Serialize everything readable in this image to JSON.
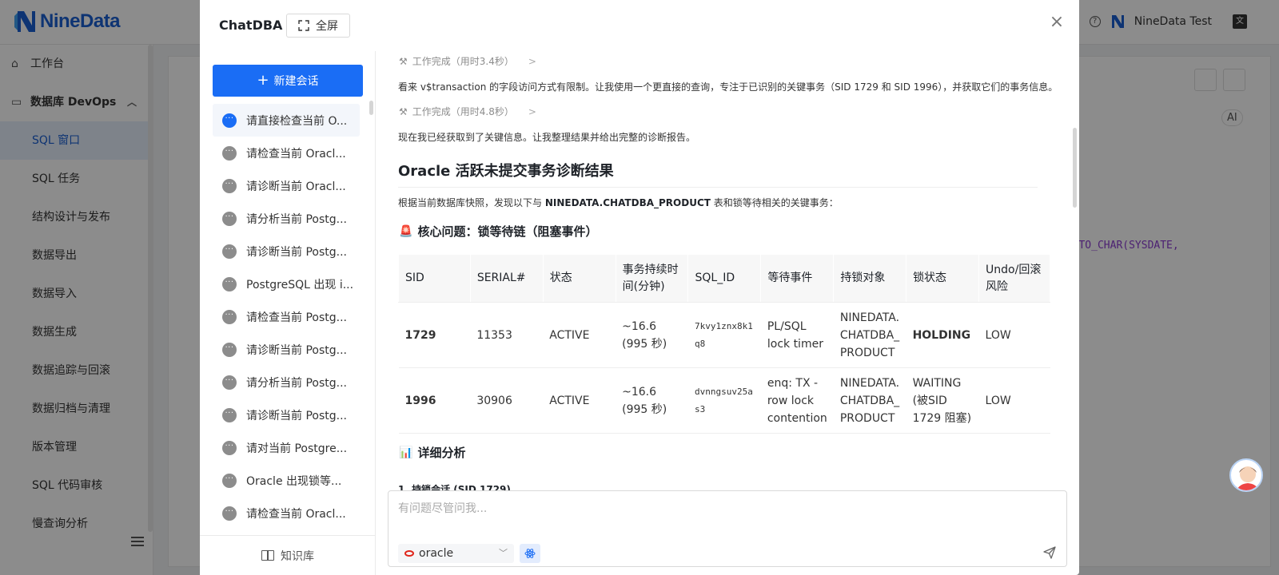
{
  "app": {
    "brand": "NineData",
    "user_name": "NineData Test",
    "help_glyph": "?",
    "lang_glyph": "文"
  },
  "sidebar": {
    "workbench": "工作台",
    "section_title": "数据库 DevOps",
    "items": [
      {
        "label": "SQL 窗口",
        "active": true
      },
      {
        "label": "SQL 任务"
      },
      {
        "label": "结构设计与发布"
      },
      {
        "label": "数据导出"
      },
      {
        "label": "数据导入"
      },
      {
        "label": "数据生成"
      },
      {
        "label": "数据追踪与回滚"
      },
      {
        "label": "数据归档与清理"
      },
      {
        "label": "版本管理"
      },
      {
        "label": "SQL 代码审核"
      },
      {
        "label": "慢查询分析"
      }
    ]
  },
  "background": {
    "code_fragment": "|| TO_CHAR(SYSDATE,",
    "ai_label": "AI"
  },
  "modal": {
    "title": "ChatDBA",
    "fullscreen_label": "全屏",
    "close_glyph": "×"
  },
  "conversations": {
    "new_chat_label": "新建会话",
    "items": [
      {
        "label": "请直接检查当前 O...",
        "active": true
      },
      {
        "label": "请检查当前 Oracl..."
      },
      {
        "label": "请诊断当前 Oracl..."
      },
      {
        "label": "请分析当前 Postg..."
      },
      {
        "label": "请诊断当前 Postg..."
      },
      {
        "label": "PostgreSQL 出现 i..."
      },
      {
        "label": "请检查当前 Postg..."
      },
      {
        "label": "请诊断当前 Postg..."
      },
      {
        "label": "请分析当前 Postg..."
      },
      {
        "label": "请诊断当前 Postg..."
      },
      {
        "label": "请对当前 Postgre..."
      },
      {
        "label": "Oracle 出现锁等..."
      },
      {
        "label": "请检查当前 Oracl..."
      }
    ],
    "knowledge_base_label": "知识库"
  },
  "chat": {
    "step1": "工作完成（用时3.4秒）",
    "para1": "看来 v$transaction 的字段访问方式有限制。让我使用一个更直接的查询，专注于已识别的关键事务（SID 1729 和 SID 1996），并获取它们的事务信息。",
    "step2": "工作完成（用时4.8秒）",
    "para2": "现在我已经获取到了关键信息。让我整理结果并给出完整的诊断报告。",
    "heading": "Oracle 活跃未提交事务诊断结果",
    "intro_prefix": "根据当前数据库快照，发现以下与 ",
    "intro_bold": "NINEDATA.CHATDBA_PRODUCT",
    "intro_suffix": " 表和锁等待相关的关键事务：",
    "core_issue": "核心问题：锁等待链（阻塞事件）",
    "table": {
      "headers": [
        "SID",
        "SERIAL#",
        "状态",
        "事务持续时间(分钟)",
        "SQL_ID",
        "等待事件",
        "持锁对象",
        "锁状态",
        "Undo/回滚风险"
      ],
      "rows": [
        [
          "1729",
          "11353",
          "ACTIVE",
          "~16.6 (995 秒)",
          "7kvy1znx8k1q8",
          "PL/SQL lock timer",
          "NINEDATA.CHATDBA_PRODUCT",
          "HOLDING",
          "LOW"
        ],
        [
          "1996",
          "30906",
          "ACTIVE",
          "~16.6 (995 秒)",
          "dvnngsuv25as3",
          "enq: TX - row lock contention",
          "NINEDATA.CHATDBA_PRODUCT",
          "WAITING (被SID 1729 阻塞)",
          "LOW"
        ]
      ]
    },
    "detail_heading": "详细分析",
    "sub_heading": "1. 持锁会话 (SID 1729)"
  },
  "input": {
    "placeholder": "有问题尽管问我...",
    "db_type": "oracle"
  },
  "colors": {
    "primary": "#1a6df5",
    "brand": "#1a5fd1",
    "oracle_red": "#e0261b"
  }
}
